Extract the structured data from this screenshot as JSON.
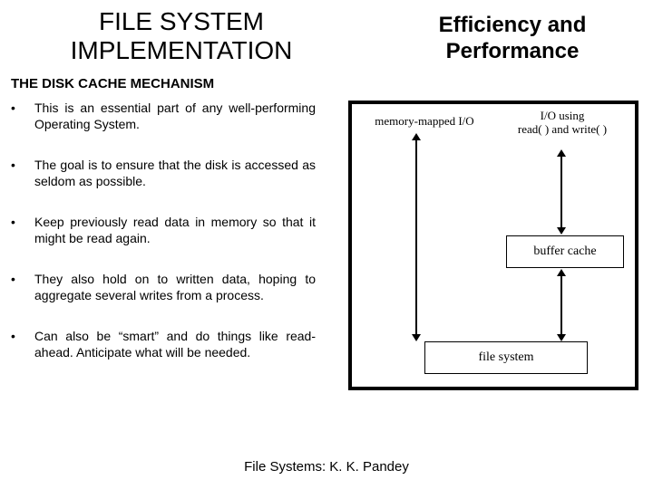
{
  "header": {
    "title_left": "FILE SYSTEM IMPLEMENTATION",
    "title_right": "Efficiency and Performance"
  },
  "subheading": "THE DISK CACHE MECHANISM",
  "bullets": [
    "This is an essential part of any well-performing Operating System.",
    "The goal is to ensure that the disk is accessed as seldom as possible.",
    "Keep previously read data in memory so that it might be read again.",
    "They also hold on to written data, hoping to aggregate several writes from a process.",
    "Can also be “smart” and do things like read-ahead.  Anticipate what will be needed."
  ],
  "figure": {
    "label_mmio": "memory-mapped I/O",
    "label_iorw_line1": "I/O using",
    "label_iorw_line2": "read( ) and write( )",
    "box_buffer_cache": "buffer cache",
    "box_file_system": "file system"
  },
  "footer": "File Systems: K. K. Pandey"
}
